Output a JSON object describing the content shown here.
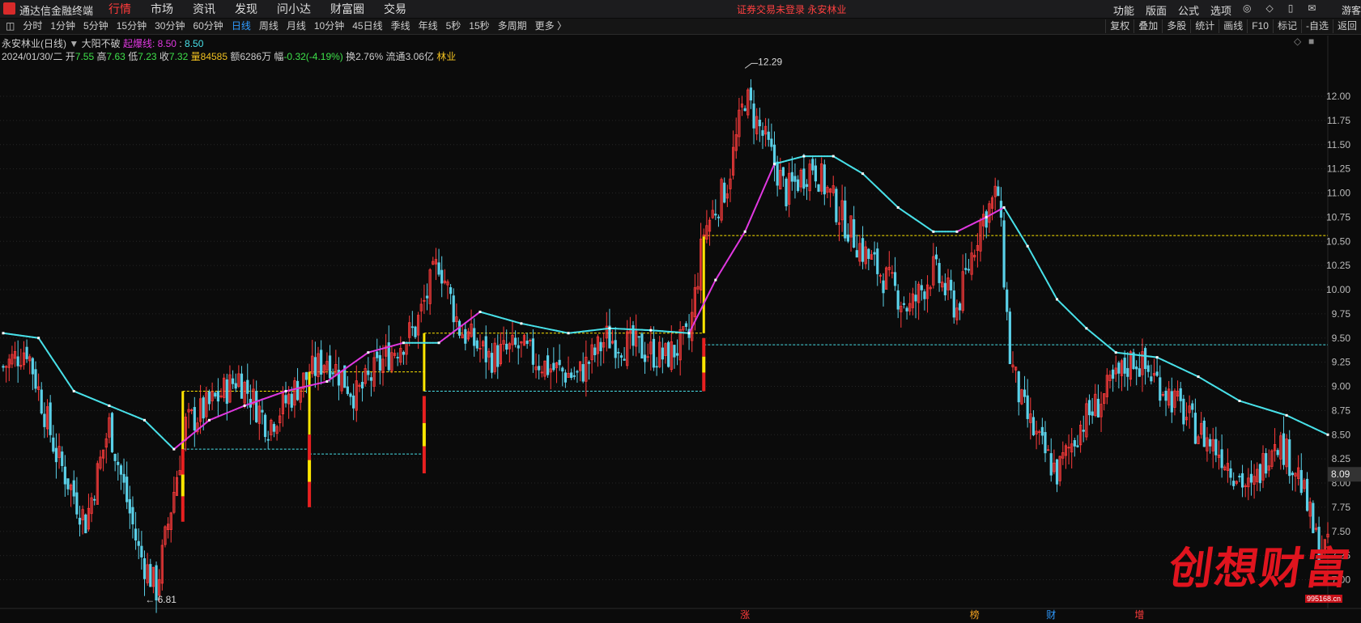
{
  "app": {
    "name": "通达信金融终端"
  },
  "menu": [
    "行情",
    "市场",
    "资讯",
    "发现",
    "问小达",
    "财富圈",
    "交易"
  ],
  "notice": "证券交易未登录  永安林业",
  "right_menu": [
    "功能",
    "版面",
    "公式",
    "选项"
  ],
  "guest": "游客",
  "periods": [
    "分时",
    "1分钟",
    "5分钟",
    "15分钟",
    "30分钟",
    "60分钟",
    "日线",
    "周线",
    "月线",
    "10分钟",
    "45日线",
    "季线",
    "年线",
    "5秒",
    "15秒",
    "多周期",
    "更多 〉"
  ],
  "tools": [
    "复权",
    "叠加",
    "多股",
    "统计",
    "画线",
    "F10",
    "标记",
    "-自选",
    "返回"
  ],
  "stock": {
    "title": "永安林业(日线)",
    "indicator": "大阳不破",
    "line_label": "起爆线:",
    "line_val1": "8.50",
    "line_val2": "8.50"
  },
  "bar": {
    "date": "2024/01/30/二",
    "open_label": "开",
    "open": "7.55",
    "high_label": "高",
    "high": "7.63",
    "low_label": "低",
    "low": "7.23",
    "close_label": "收",
    "close": "7.32",
    "vol_label": "量",
    "vol": "84585",
    "amt_label": "额",
    "amt": "6286万",
    "chg_label": "幅",
    "chg": "-0.32(-4.19%)",
    "turn_label": "换",
    "turn": "2.76%",
    "float_label": "流通",
    "float": "3.06亿",
    "industry": "林业"
  },
  "markers": {
    "high_label": "12.29",
    "low_label": "6.81",
    "last_price": "8.09",
    "events": [
      "涨",
      "榜",
      "财",
      "增"
    ]
  },
  "colors": {
    "up": "#ff3c3c",
    "down": "#5ad0e8",
    "ma_up": "#e038e0",
    "ma_down": "#48e0e8",
    "yellow": "#ffe600",
    "bg": "#0b0b0b"
  },
  "watermark": {
    "text": "创想财富",
    "site": "995168.cn"
  },
  "chart_data": {
    "type": "candlestick",
    "y_ticks": [
      "12.00",
      "11.75",
      "11.50",
      "11.25",
      "11.00",
      "10.75",
      "10.50",
      "10.25",
      "10.00",
      "9.75",
      "9.50",
      "9.25",
      "9.00",
      "8.75",
      "8.50",
      "8.25",
      "8.00",
      "7.75",
      "7.50",
      "7.25",
      "7.00"
    ],
    "ylim": [
      6.75,
      12.5
    ],
    "close_keypoints": [
      [
        0,
        9.2
      ],
      [
        8,
        9.4
      ],
      [
        18,
        8.3
      ],
      [
        28,
        7.6
      ],
      [
        36,
        8.6
      ],
      [
        46,
        7.3
      ],
      [
        52,
        6.9
      ],
      [
        62,
        8.6
      ],
      [
        70,
        8.8
      ],
      [
        80,
        9.1
      ],
      [
        90,
        8.6
      ],
      [
        100,
        9.0
      ],
      [
        110,
        9.3
      ],
      [
        120,
        8.9
      ],
      [
        130,
        9.3
      ],
      [
        140,
        9.6
      ],
      [
        148,
        10.3
      ],
      [
        155,
        9.6
      ],
      [
        165,
        9.3
      ],
      [
        175,
        9.4
      ],
      [
        185,
        9.2
      ],
      [
        195,
        9.1
      ],
      [
        205,
        9.5
      ],
      [
        215,
        9.4
      ],
      [
        225,
        9.3
      ],
      [
        233,
        9.5
      ],
      [
        238,
        10.6
      ],
      [
        246,
        11.1
      ],
      [
        252,
        12.0
      ],
      [
        258,
        11.6
      ],
      [
        266,
        11.0
      ],
      [
        275,
        11.3
      ],
      [
        284,
        10.8
      ],
      [
        292,
        10.4
      ],
      [
        300,
        10.1
      ],
      [
        308,
        9.8
      ],
      [
        316,
        10.2
      ],
      [
        324,
        9.8
      ],
      [
        332,
        10.7
      ],
      [
        338,
        11.0
      ],
      [
        342,
        9.3
      ],
      [
        346,
        8.8
      ],
      [
        352,
        8.4
      ],
      [
        358,
        8.1
      ],
      [
        366,
        8.6
      ],
      [
        374,
        8.9
      ],
      [
        384,
        9.3
      ],
      [
        394,
        9.0
      ],
      [
        404,
        8.6
      ],
      [
        414,
        8.3
      ],
      [
        424,
        7.9
      ],
      [
        432,
        8.5
      ],
      [
        440,
        8.1
      ],
      [
        446,
        7.4
      ],
      [
        450,
        7.3
      ]
    ],
    "ma_keypoints": [
      [
        0,
        9.55
      ],
      [
        12,
        9.5
      ],
      [
        24,
        8.95
      ],
      [
        36,
        8.8
      ],
      [
        48,
        8.65
      ],
      [
        58,
        8.35
      ],
      [
        70,
        8.65
      ],
      [
        82,
        8.8
      ],
      [
        96,
        8.95
      ],
      [
        110,
        9.05
      ],
      [
        124,
        9.35
      ],
      [
        136,
        9.45
      ],
      [
        148,
        9.45
      ],
      [
        162,
        9.77
      ],
      [
        176,
        9.65
      ],
      [
        192,
        9.55
      ],
      [
        206,
        9.6
      ],
      [
        220,
        9.58
      ],
      [
        233,
        9.55
      ],
      [
        242,
        10.1
      ],
      [
        252,
        10.6
      ],
      [
        262,
        11.3
      ],
      [
        272,
        11.38
      ],
      [
        282,
        11.38
      ],
      [
        292,
        11.2
      ],
      [
        304,
        10.85
      ],
      [
        316,
        10.6
      ],
      [
        324,
        10.6
      ],
      [
        334,
        10.75
      ],
      [
        340,
        10.85
      ],
      [
        348,
        10.45
      ],
      [
        358,
        9.9
      ],
      [
        368,
        9.6
      ],
      [
        378,
        9.35
      ],
      [
        392,
        9.3
      ],
      [
        406,
        9.1
      ],
      [
        420,
        8.85
      ],
      [
        436,
        8.7
      ],
      [
        450,
        8.5
      ]
    ],
    "ma_up_ranges": [
      [
        58,
        136
      ],
      [
        148,
        162
      ],
      [
        233,
        262
      ],
      [
        324,
        340
      ]
    ],
    "yellow_signals": [
      [
        61,
        8.95,
        8.35
      ],
      [
        104,
        9.15,
        8.5
      ],
      [
        143,
        9.55,
        8.95
      ],
      [
        238,
        10.55,
        9.55
      ]
    ],
    "signal_dips": [
      [
        61,
        8.35,
        7.6
      ],
      [
        104,
        8.5,
        7.75
      ],
      [
        143,
        8.9,
        8.1
      ],
      [
        238,
        9.5,
        8.95
      ]
    ],
    "ref_lines": [
      {
        "y": 10.56,
        "x0": 238,
        "x1": 450,
        "color": "yellow"
      },
      {
        "y": 9.43,
        "x0": 238,
        "x1": 450,
        "color": "cyan"
      },
      {
        "y": 9.55,
        "x0": 143,
        "x1": 238,
        "color": "yellow"
      },
      {
        "y": 8.95,
        "x0": 143,
        "x1": 238,
        "color": "cyan"
      },
      {
        "y": 9.15,
        "x0": 104,
        "x1": 143,
        "color": "yellow"
      },
      {
        "y": 8.3,
        "x0": 104,
        "x1": 143,
        "color": "cyan"
      },
      {
        "y": 8.95,
        "x0": 61,
        "x1": 104,
        "color": "yellow"
      },
      {
        "y": 8.35,
        "x0": 61,
        "x1": 104,
        "color": "cyan"
      }
    ],
    "high_point": [
      252,
      12.29
    ],
    "low_point": [
      46,
      6.81
    ],
    "event_positions": [
      252,
      330,
      356,
      386
    ]
  }
}
